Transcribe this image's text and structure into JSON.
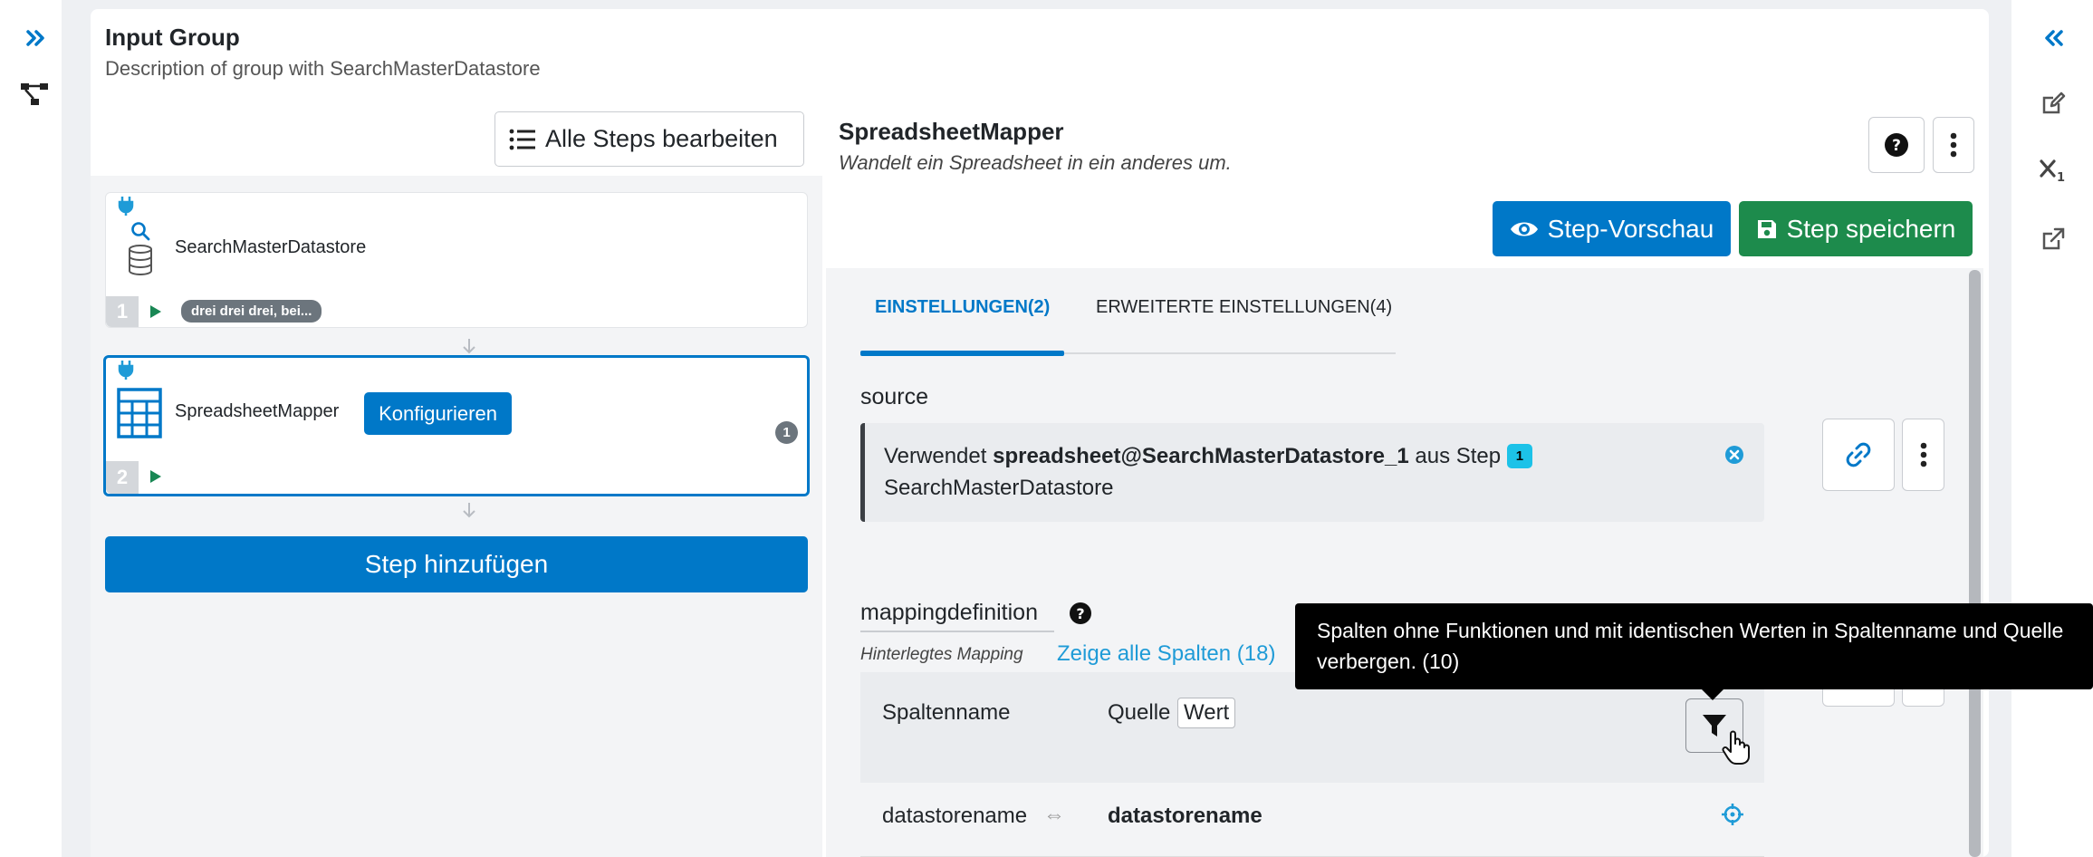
{
  "colors": {
    "primary": "#0078c8",
    "success": "#1d8b4c",
    "info_badge": "#1cc2e8",
    "accent_blue": "#1f9bd7"
  },
  "left_rail": {
    "expand_icon": "double-chevron-right-icon",
    "tree_icon": "workflow-tree-icon"
  },
  "right_rail": {
    "collapse_icon": "double-chevron-left-icon",
    "edit_icon": "edit-icon",
    "subscript_icon": "subscript-icon",
    "external_icon": "external-link-icon"
  },
  "group": {
    "title": "Input Group",
    "description": "Description of group with SearchMasterDatastore"
  },
  "steps_panel": {
    "edit_all_label": "Alle Steps bearbeiten",
    "add_step_label": "Step hinzufügen",
    "steps": [
      {
        "number": "1",
        "name": "SearchMasterDatastore",
        "tag": "drei drei drei, bei..."
      },
      {
        "number": "2",
        "name": "SpreadsheetMapper",
        "configure_label": "Konfigurieren",
        "count_badge": "1"
      }
    ]
  },
  "detail": {
    "title": "SpreadsheetMapper",
    "description": "Wandelt ein Spreadsheet in ein anderes um.",
    "preview_label": "Step-Vorschau",
    "save_label": "Step speichern",
    "tabs": [
      {
        "label": "EINSTELLUNGEN(2)",
        "active": true
      },
      {
        "label": "ERWEITERTE EINSTELLUNGEN(4)",
        "active": false
      }
    ],
    "source": {
      "label": "source",
      "text_prefix": "Verwendet",
      "variable": "spreadsheet@SearchMasterDatastore_1",
      "text_mid": "aus Step",
      "step_badge": "1",
      "step_name": "SearchMasterDatastore"
    },
    "mapping": {
      "label": "mappingdefinition",
      "hint": "Hinterlegtes Mapping",
      "show_all_link": "Zeige alle Spalten (18)",
      "col_name": "Spaltenname",
      "col_source": "Quelle",
      "col_value": "Wert",
      "rows": [
        {
          "name": "datastorename",
          "arrow": "⇔",
          "source": "datastorename"
        }
      ]
    },
    "tooltip": "Spalten ohne Funktionen und mit identischen Werten in Spaltenname und Quelle verbergen. (10)"
  }
}
